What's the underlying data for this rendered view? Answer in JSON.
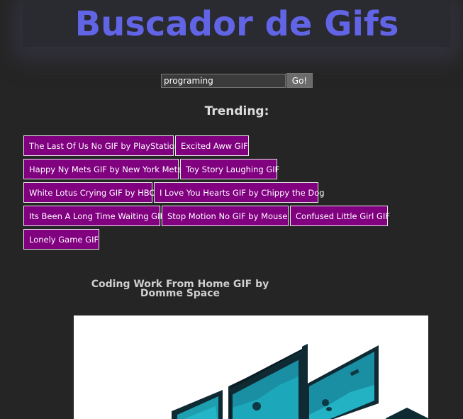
{
  "header": {
    "title": "Buscador de Gifs"
  },
  "search": {
    "value": "programing",
    "button_label": "Go!"
  },
  "trending": {
    "title": "Trending:",
    "items": [
      "The Last Of Us No GIF by PlayStation",
      "Excited Aww GIF",
      "Happy Ny Mets GIF by New York Mets",
      "Toy Story Laughing GIF",
      "White Lotus Crying GIF by HBO",
      "I Love You Hearts GIF by Chippy the Dog",
      "Its Been A Long Time Waiting GIF",
      "Stop Motion No GIF by Mouse",
      "Confused Little Girl GIF",
      "Lonely Game GIF"
    ]
  },
  "results": [
    {
      "title": "Coding Work From Home GIF by Domme Space"
    }
  ],
  "colors": {
    "title": "#6264e6",
    "trending_button": "#800080",
    "background": "#252525"
  }
}
